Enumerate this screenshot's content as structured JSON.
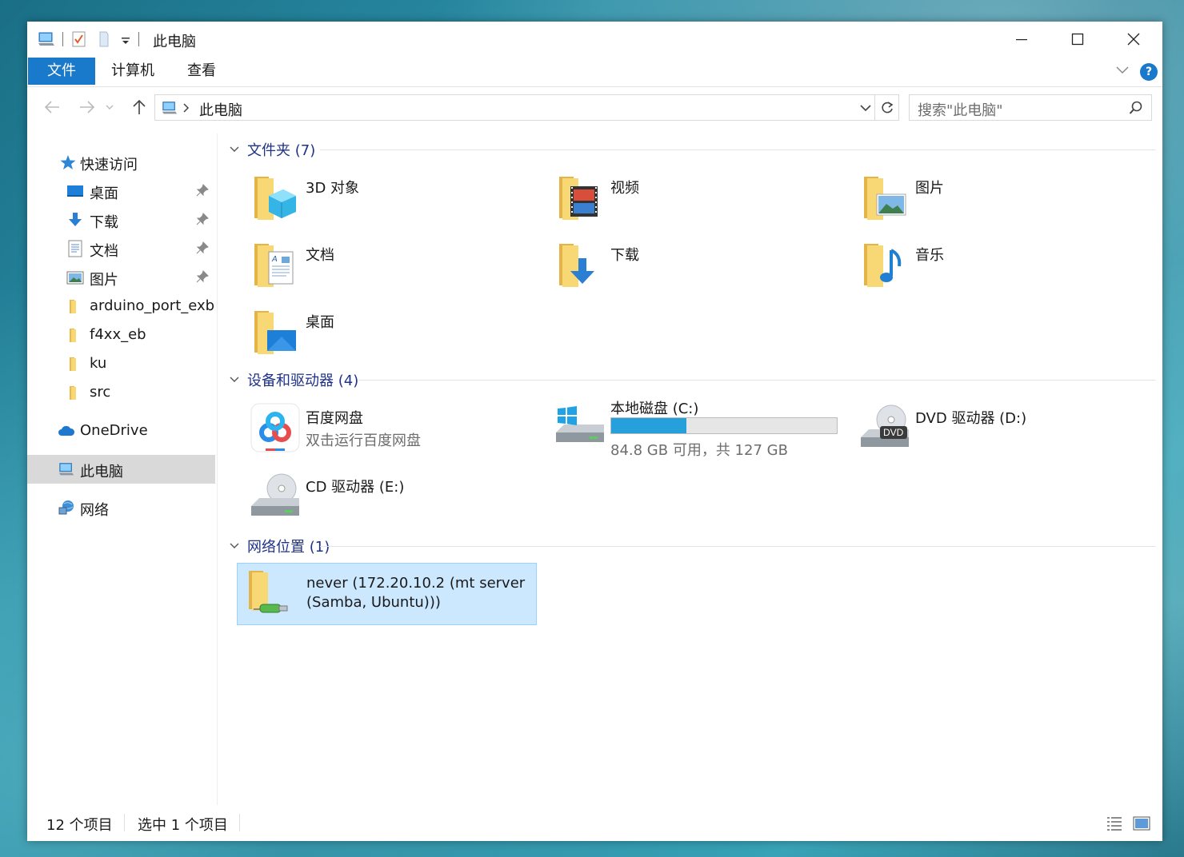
{
  "window": {
    "title": "此电脑",
    "controls": {
      "minimize": "minimize",
      "maximize": "maximize",
      "close": "close"
    }
  },
  "ribbon": {
    "tabs": [
      "文件",
      "计算机",
      "查看"
    ],
    "help": "?"
  },
  "address": {
    "path": "此电脑",
    "search_placeholder": "搜索\"此电脑\""
  },
  "sidebar": {
    "quick_access": "快速访问",
    "items": [
      {
        "label": "桌面",
        "icon": "desktop-icon",
        "pinned": true
      },
      {
        "label": "下载",
        "icon": "download-arrow-icon",
        "pinned": true
      },
      {
        "label": "文档",
        "icon": "document-icon",
        "pinned": true
      },
      {
        "label": "图片",
        "icon": "picture-icon",
        "pinned": true
      },
      {
        "label": "arduino_port_exb",
        "icon": "folder-icon",
        "pinned": false
      },
      {
        "label": "f4xx_eb",
        "icon": "folder-icon",
        "pinned": false
      },
      {
        "label": "ku",
        "icon": "folder-icon",
        "pinned": false
      },
      {
        "label": "src",
        "icon": "folder-icon",
        "pinned": false
      }
    ],
    "onedrive": "OneDrive",
    "this_pc": "此电脑",
    "network": "网络"
  },
  "groups": {
    "folders": {
      "title": "文件夹 (7)",
      "items": [
        "3D 对象",
        "视频",
        "图片",
        "文档",
        "下载",
        "音乐",
        "桌面"
      ]
    },
    "devices": {
      "title": "设备和驱动器 (4)",
      "baidu": {
        "name": "百度网盘",
        "sub": "双击运行百度网盘"
      },
      "cdrive": {
        "name": "本地磁盘 (C:)",
        "free_text": "84.8 GB 可用，共 127 GB",
        "used_fraction": 0.332
      },
      "dvd": {
        "name": "DVD 驱动器 (D:)",
        "badge": "DVD"
      },
      "cd": {
        "name": "CD 驱动器 (E:)"
      }
    },
    "network": {
      "title": "网络位置 (1)",
      "item_line1": "never (172.20.10.2 (mt server",
      "item_line2": "(Samba, Ubuntu)))"
    }
  },
  "status": {
    "count": "12 个项目",
    "selected": "选中 1 个项目"
  },
  "colors": {
    "accent": "#1979ca",
    "group_title": "#1e3287",
    "selection": "#cce8ff",
    "drive_fill": "#26a0da",
    "folder": "#f8d775"
  }
}
